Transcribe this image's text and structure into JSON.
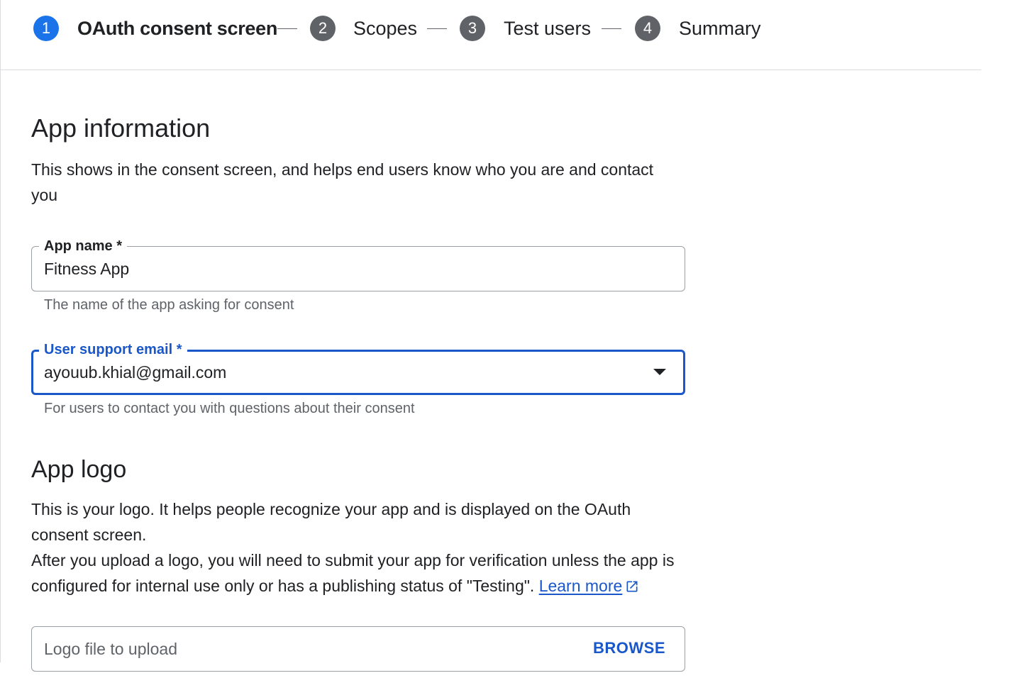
{
  "stepper": {
    "steps": [
      {
        "number": "1",
        "label": "OAuth consent screen"
      },
      {
        "number": "2",
        "label": "Scopes"
      },
      {
        "number": "3",
        "label": "Test users"
      },
      {
        "number": "4",
        "label": "Summary"
      }
    ],
    "active_step": 1
  },
  "app_info": {
    "title": "App information",
    "description": "This shows in the consent screen, and helps end users know who you are and contact you",
    "app_name": {
      "label": "App name *",
      "value": "Fitness App",
      "helper": "The name of the app asking for consent"
    },
    "support_email": {
      "label": "User support email *",
      "value": "ayouub.khial@gmail.com",
      "helper": "For users to contact you with questions about their consent"
    }
  },
  "app_logo": {
    "title": "App logo",
    "description_line1": "This is your logo. It helps people recognize your app and is displayed on the OAuth consent screen.",
    "description_line2": "After you upload a logo, you will need to submit your app for verification unless the app is configured for internal use only or has a publishing status of \"Testing\".",
    "learn_more": "Learn more",
    "upload_placeholder": "Logo file to upload",
    "browse_label": "BROWSE"
  },
  "colors": {
    "accent": "#1a73e8",
    "link": "#1a57c9",
    "step_inactive": "#5f6368"
  }
}
